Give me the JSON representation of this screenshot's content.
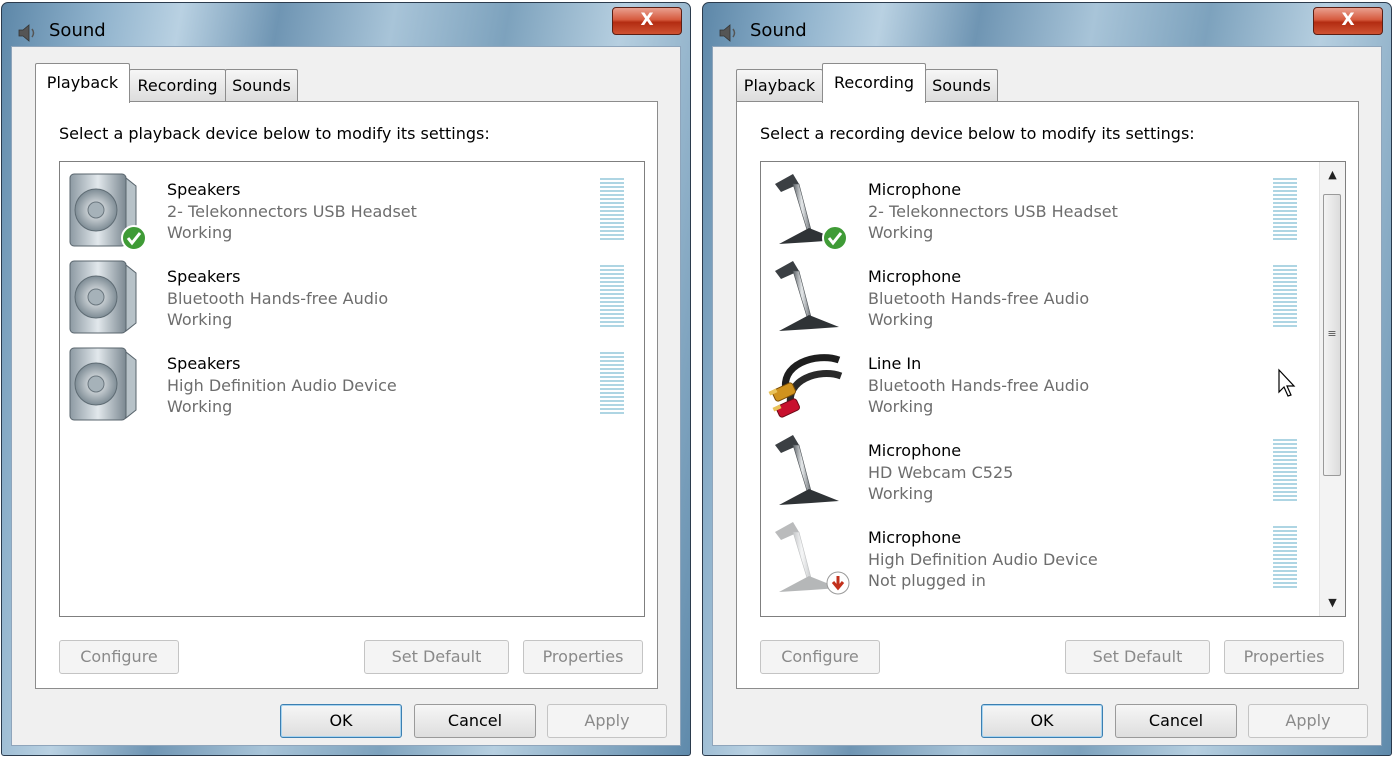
{
  "windows": [
    {
      "title": "Sound",
      "close_label": "X",
      "tabs": [
        {
          "label": "Playback",
          "active": true
        },
        {
          "label": "Recording",
          "active": false
        },
        {
          "label": "Sounds",
          "active": false
        }
      ],
      "instruction": "Select a playback device below to modify its settings:",
      "devices": [
        {
          "name": "Speakers",
          "description": "2- Telekonnectors USB Headset",
          "status": "Working",
          "icon": "speaker-icon",
          "badge": "default-check"
        },
        {
          "name": "Speakers",
          "description": "Bluetooth Hands-free Audio",
          "status": "Working",
          "icon": "speaker-icon",
          "badge": ""
        },
        {
          "name": "Speakers",
          "description": "High Definition Audio Device",
          "status": "Working",
          "icon": "speaker-icon",
          "badge": ""
        }
      ],
      "buttons": {
        "configure": "Configure",
        "set_default": "Set Default",
        "properties": "Properties"
      },
      "footer": {
        "ok": "OK",
        "cancel": "Cancel",
        "apply": "Apply"
      }
    },
    {
      "title": "Sound",
      "close_label": "X",
      "tabs": [
        {
          "label": "Playback",
          "active": false
        },
        {
          "label": "Recording",
          "active": true
        },
        {
          "label": "Sounds",
          "active": false
        }
      ],
      "instruction": "Select a recording device below to modify its settings:",
      "devices": [
        {
          "name": "Microphone",
          "description": "2- Telekonnectors USB Headset",
          "status": "Working",
          "icon": "microphone-icon",
          "badge": "default-check"
        },
        {
          "name": "Microphone",
          "description": "Bluetooth Hands-free Audio",
          "status": "Working",
          "icon": "microphone-icon",
          "badge": ""
        },
        {
          "name": "Line In",
          "description": "Bluetooth Hands-free Audio",
          "status": "Working",
          "icon": "rca-cable-icon",
          "badge": ""
        },
        {
          "name": "Microphone",
          "description": "HD Webcam C525",
          "status": "Working",
          "icon": "microphone-icon",
          "badge": ""
        },
        {
          "name": "Microphone",
          "description": "High Definition Audio Device",
          "status": "Not plugged in",
          "icon": "microphone-icon",
          "badge": "unplugged-arrow"
        }
      ],
      "buttons": {
        "configure": "Configure",
        "set_default": "Set Default",
        "properties": "Properties"
      },
      "footer": {
        "ok": "OK",
        "cancel": "Cancel",
        "apply": "Apply"
      }
    }
  ],
  "colors": {
    "meter": "#aed5e3",
    "close_button": "#c7432a",
    "muted_text": "#6d6d6d"
  }
}
